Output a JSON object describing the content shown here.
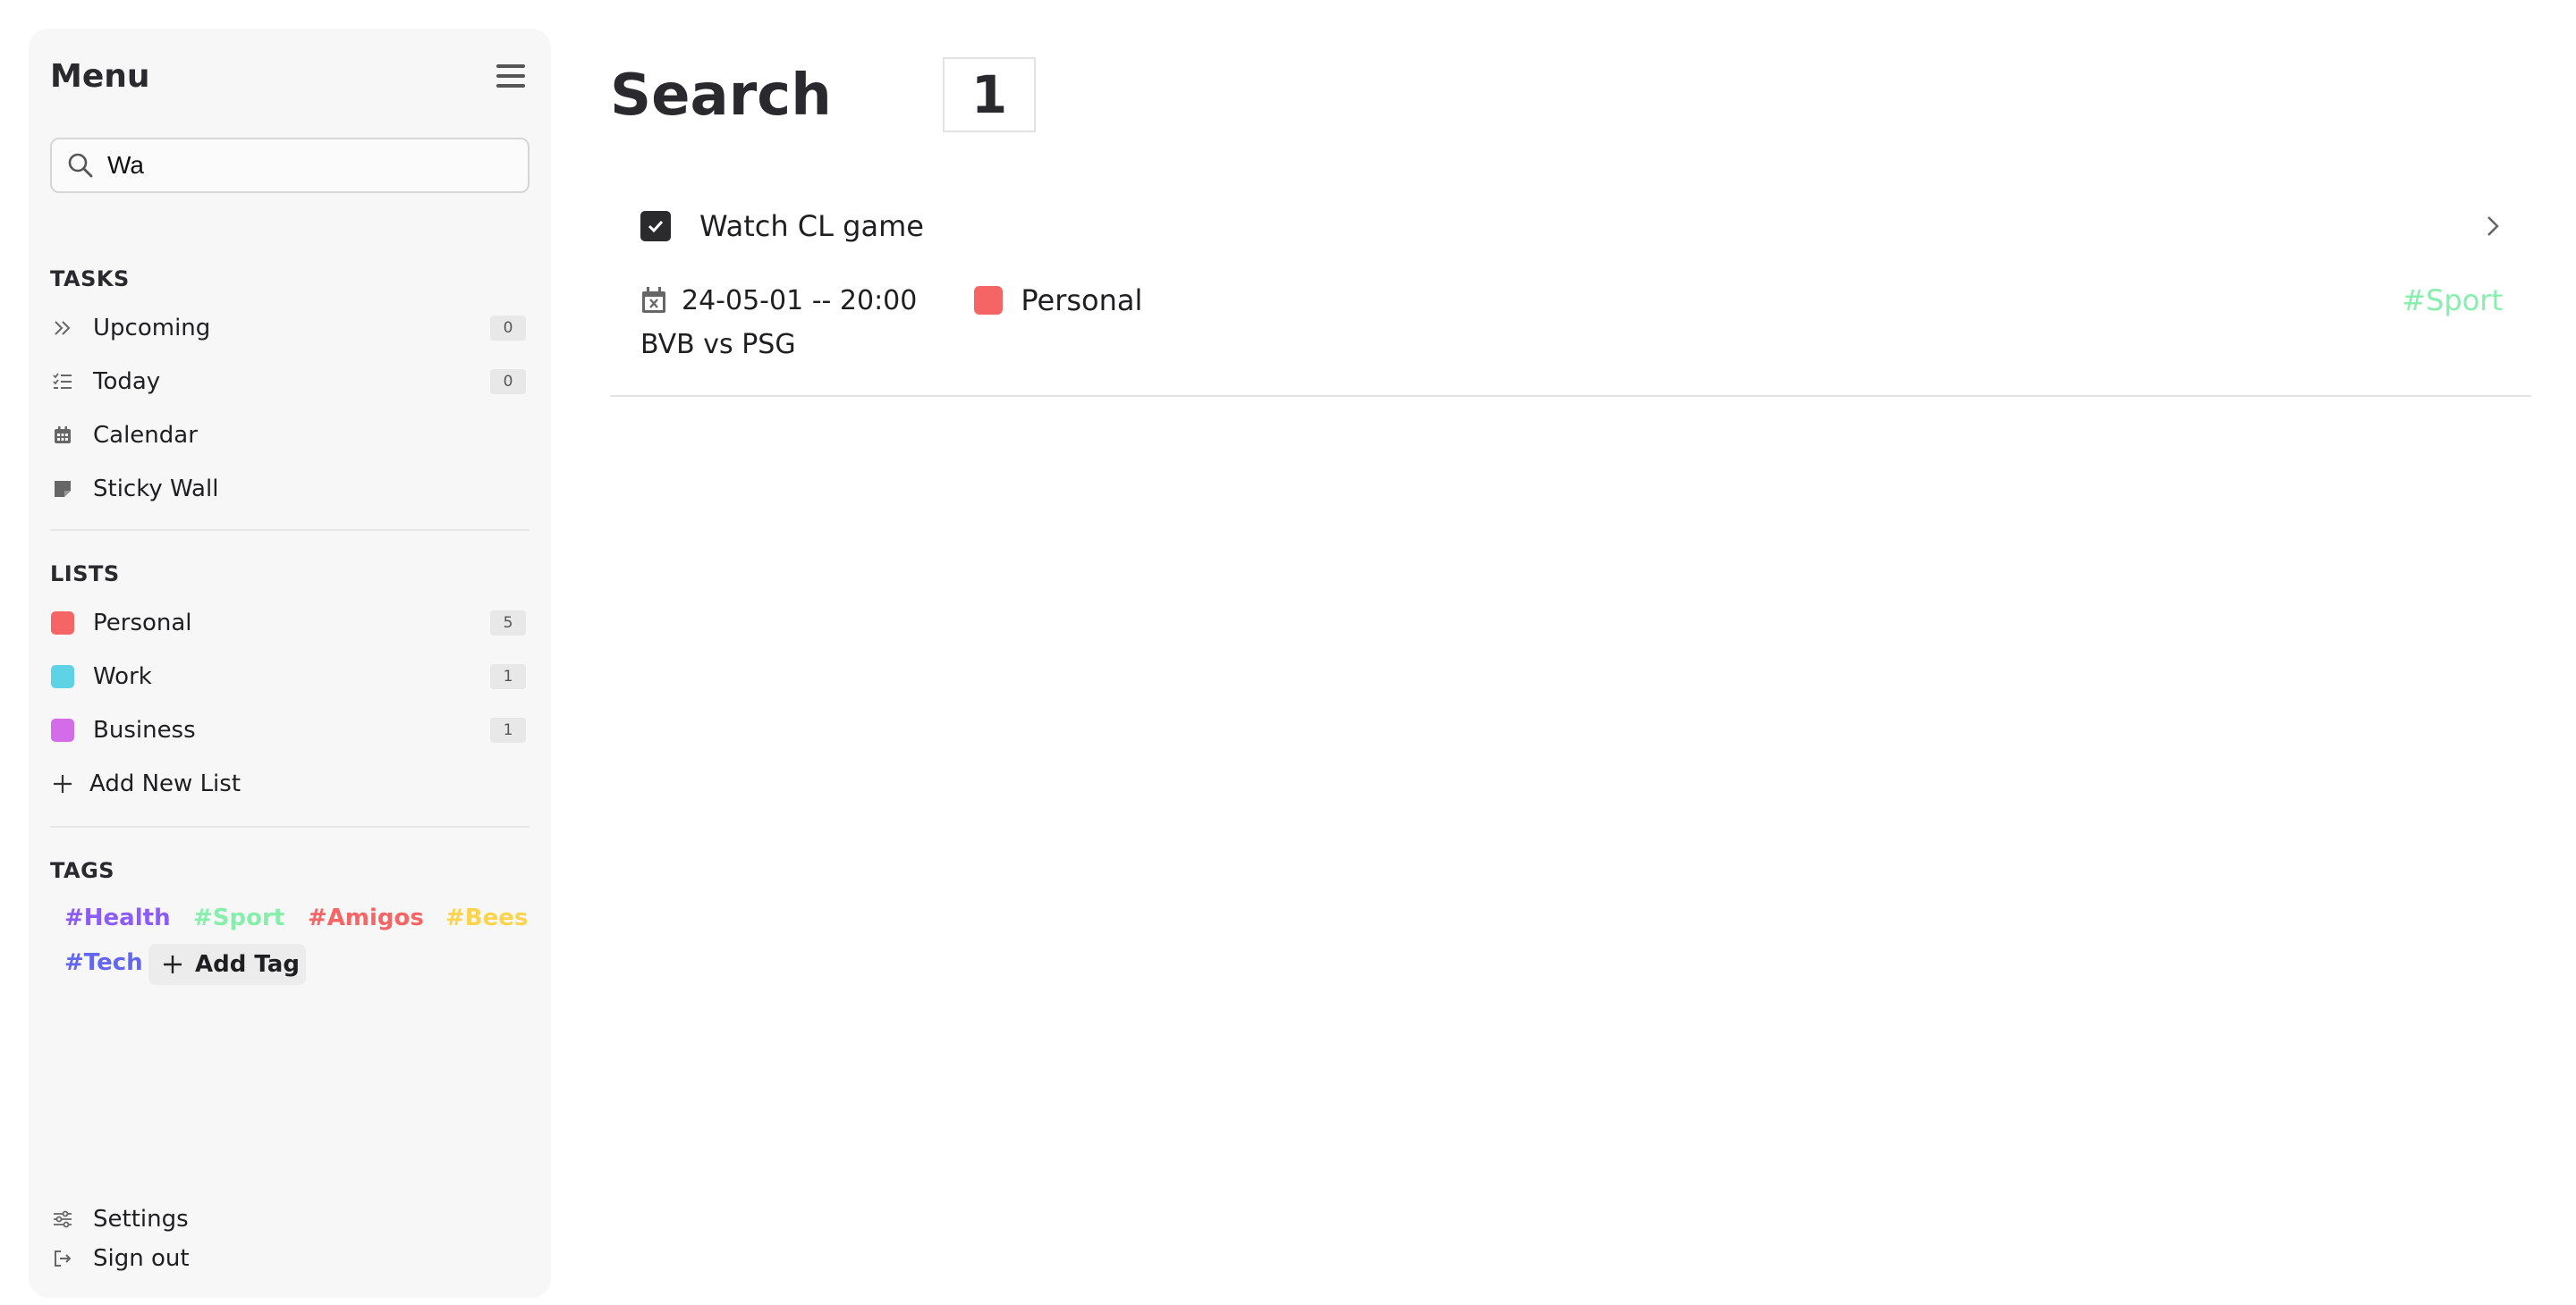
{
  "sidebar": {
    "title": "Menu",
    "search": {
      "value": "Wa",
      "placeholder": ""
    },
    "tasks_label": "TASKS",
    "tasks": [
      {
        "label": "Upcoming",
        "count": "0",
        "icon": "double-chevron-right-icon"
      },
      {
        "label": "Today",
        "count": "0",
        "icon": "checklist-icon"
      },
      {
        "label": "Calendar",
        "icon": "calendar-icon"
      },
      {
        "label": "Sticky Wall",
        "icon": "sticky-note-icon"
      }
    ],
    "lists_label": "LISTS",
    "lists": [
      {
        "label": "Personal",
        "count": "5",
        "color": "#f56565"
      },
      {
        "label": "Work",
        "count": "1",
        "color": "#5ed3e6"
      },
      {
        "label": "Business",
        "count": "1",
        "color": "#d46be8"
      }
    ],
    "add_list_label": "Add New List",
    "tags_label": "TAGS",
    "tags": [
      {
        "label": "#Health",
        "color": "#8b5cf6"
      },
      {
        "label": "#Sport",
        "color": "#86efac"
      },
      {
        "label": "#Amigos",
        "color": "#f56565"
      },
      {
        "label": "#Bees",
        "color": "#fcd34d"
      },
      {
        "label": "#Tech",
        "color": "#6366f1"
      }
    ],
    "add_tag_label": "Add Tag",
    "settings_label": "Settings",
    "sign_out_label": "Sign out"
  },
  "main": {
    "title": "Search",
    "result_count": "1",
    "results": [
      {
        "title": "Watch CL game",
        "checked": true,
        "due": "24-05-01 -- 20:00",
        "list_name": "Personal",
        "list_color": "#f56565",
        "tag": "#Sport",
        "tag_color": "#86efac",
        "description": "BVB vs PSG"
      }
    ]
  }
}
